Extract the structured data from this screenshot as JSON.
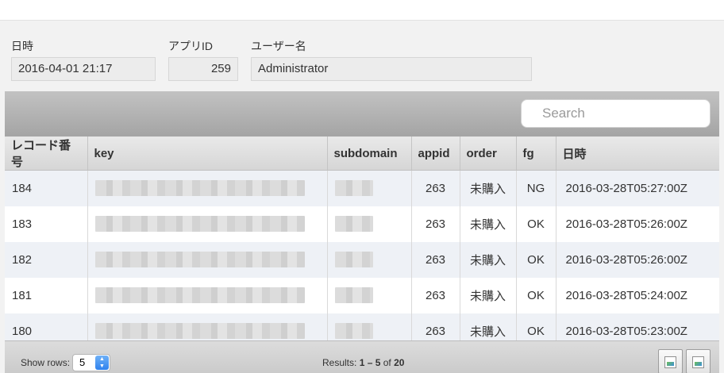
{
  "header_fields": {
    "datetime": {
      "label": "日時",
      "value": "2016-04-01 21:17"
    },
    "app_id": {
      "label": "アプリID",
      "value": "259"
    },
    "username": {
      "label": "ユーザー名",
      "value": "Administrator"
    }
  },
  "search": {
    "placeholder": "Search"
  },
  "table": {
    "columns": [
      "レコード番号",
      "key",
      "subdomain",
      "appid",
      "order",
      "fg",
      "日時"
    ],
    "rows": [
      {
        "record": "184",
        "appid": "263",
        "order": "未購入",
        "fg": "NG",
        "datetime": "2016-03-28T05:27:00Z"
      },
      {
        "record": "183",
        "appid": "263",
        "order": "未購入",
        "fg": "OK",
        "datetime": "2016-03-28T05:26:00Z"
      },
      {
        "record": "182",
        "appid": "263",
        "order": "未購入",
        "fg": "OK",
        "datetime": "2016-03-28T05:26:00Z"
      },
      {
        "record": "181",
        "appid": "263",
        "order": "未購入",
        "fg": "OK",
        "datetime": "2016-03-28T05:24:00Z"
      },
      {
        "record": "180",
        "appid": "263",
        "order": "未購入",
        "fg": "OK",
        "datetime": "2016-03-28T05:23:00Z"
      }
    ]
  },
  "footer": {
    "show_rows_label": "Show rows:",
    "rows_value": "5",
    "results_prefix": "Results:",
    "results_range": "1 – 5",
    "results_of": "of",
    "results_total": "20"
  },
  "icons": {
    "select_arrow": "updown-chevron-icon",
    "prev_page": "broken-image-icon",
    "next_page": "broken-image-icon"
  }
}
